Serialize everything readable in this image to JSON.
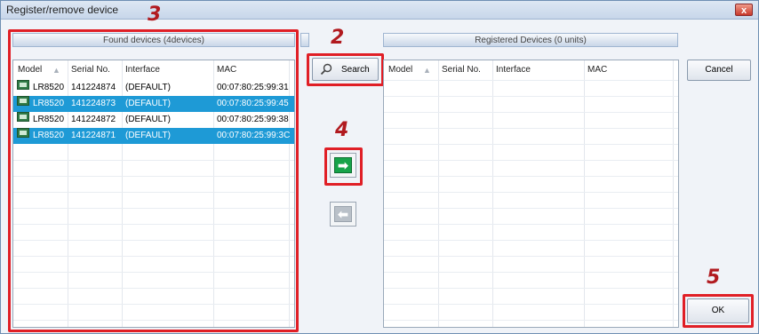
{
  "window": {
    "title": "Register/remove device",
    "close_glyph": "x"
  },
  "steps": {
    "found": "3",
    "search": "2",
    "register": "4",
    "ok": "5"
  },
  "found_panel": {
    "header": "Found devices (4devices)",
    "columns": {
      "model": "Model",
      "serial": "Serial No.",
      "interface": "Interface",
      "mac": "MAC"
    },
    "sort_glyph": "▲",
    "rows": [
      {
        "model": "LR8520",
        "serial": "141224874",
        "interface": "(DEFAULT)",
        "mac": "00:07:80:25:99:31",
        "selected": false
      },
      {
        "model": "LR8520",
        "serial": "141224873",
        "interface": "(DEFAULT)",
        "mac": "00:07:80:25:99:45",
        "selected": true
      },
      {
        "model": "LR8520",
        "serial": "141224872",
        "interface": "(DEFAULT)",
        "mac": "00:07:80:25:99:38",
        "selected": false
      },
      {
        "model": "LR8520",
        "serial": "141224871",
        "interface": "(DEFAULT)",
        "mac": "00:07:80:25:99:3C",
        "selected": true
      }
    ]
  },
  "registered_panel": {
    "header": "Registered Devices (0 units)",
    "columns": {
      "model": "Model",
      "serial": "Serial No.",
      "interface": "Interface",
      "mac": "MAC"
    },
    "sort_glyph": "▲"
  },
  "buttons": {
    "search": "Search",
    "cancel": "Cancel",
    "ok": "OK",
    "add_glyph": "➡",
    "remove_glyph": "⬅"
  },
  "icons": {
    "search": "magnifier-icon",
    "device": "device-icon"
  },
  "colors": {
    "selection": "#1e9ad6",
    "callout": "#e01f26",
    "step_number": "#b11a1f",
    "add_arrow": "#17a34a"
  }
}
